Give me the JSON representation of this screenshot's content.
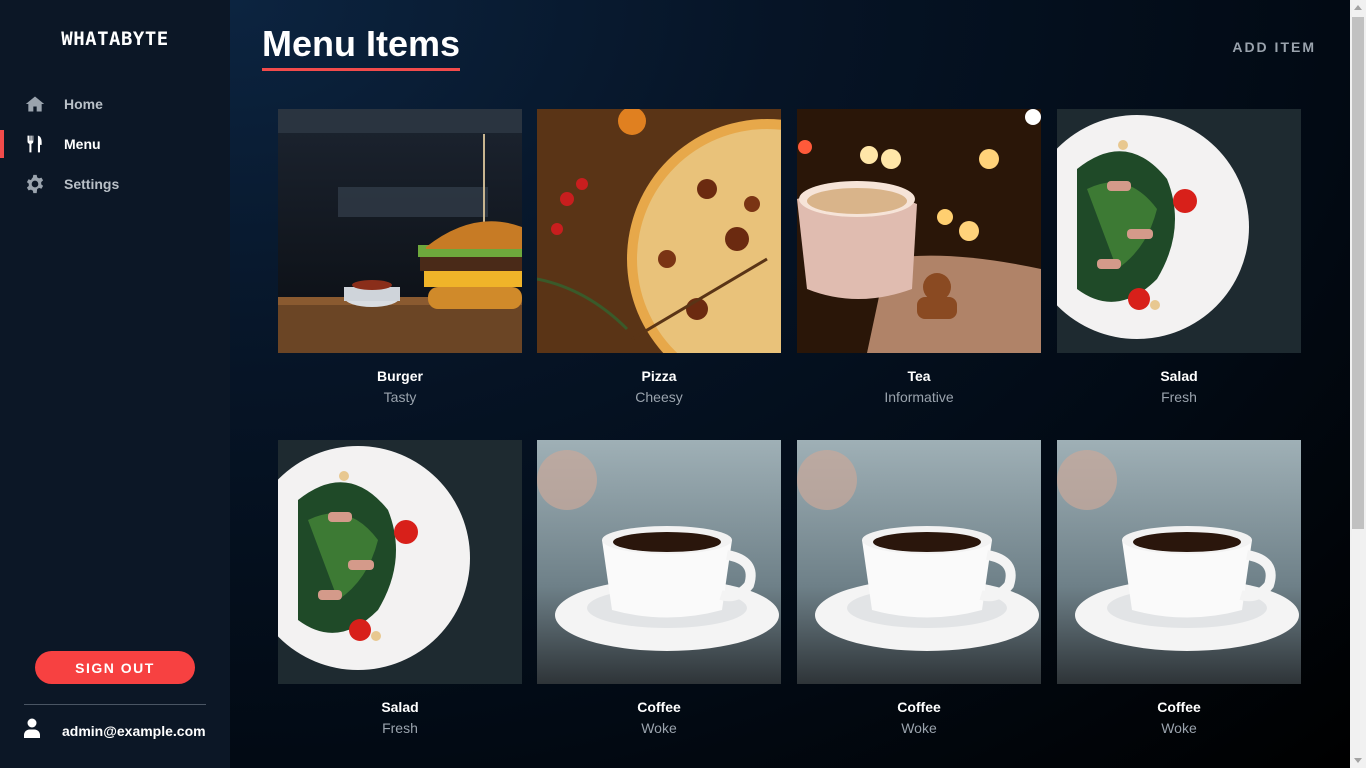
{
  "app": {
    "brand": "WHATABYTE"
  },
  "sidebar": {
    "items": [
      {
        "label": "Home",
        "icon": "home-icon",
        "active": false
      },
      {
        "label": "Menu",
        "icon": "utensils-icon",
        "active": true
      },
      {
        "label": "Settings",
        "icon": "gear-icon",
        "active": false
      }
    ],
    "signout_label": "SIGN OUT",
    "user_email": "admin@example.com"
  },
  "header": {
    "title": "Menu Items",
    "add_item_label": "ADD ITEM"
  },
  "menu_items": [
    {
      "name": "Burger",
      "description": "Tasty",
      "image": "burger-photo"
    },
    {
      "name": "Pizza",
      "description": "Cheesy",
      "image": "pizza-photo"
    },
    {
      "name": "Tea",
      "description": "Informative",
      "image": "tea-photo"
    },
    {
      "name": "Salad",
      "description": "Fresh",
      "image": "salad-photo"
    },
    {
      "name": "Salad",
      "description": "Fresh",
      "image": "salad-photo"
    },
    {
      "name": "Coffee",
      "description": "Woke",
      "image": "coffee-photo"
    },
    {
      "name": "Coffee",
      "description": "Woke",
      "image": "coffee-photo"
    },
    {
      "name": "Coffee",
      "description": "Woke",
      "image": "coffee-photo"
    }
  ],
  "colors": {
    "accent": "#f24b4b",
    "sidebar_bg": "#0c1726",
    "muted_text": "#9aa3ad"
  }
}
